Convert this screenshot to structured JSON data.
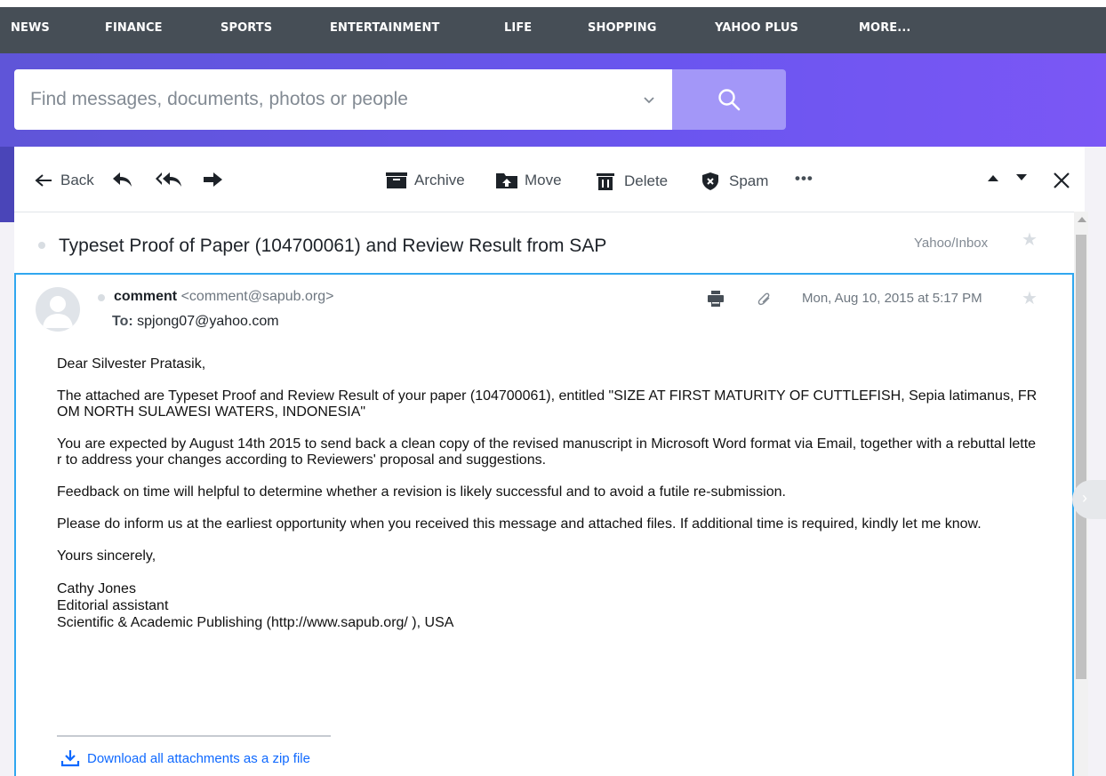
{
  "nav": {
    "items": [
      "NEWS",
      "FINANCE",
      "SPORTS",
      "ENTERTAINMENT",
      "LIFE",
      "SHOPPING",
      "YAHOO PLUS",
      "MORE..."
    ]
  },
  "search": {
    "placeholder": "Find messages, documents, photos or people"
  },
  "toolbar": {
    "back_label": "Back",
    "archive_label": "Archive",
    "move_label": "Move",
    "delete_label": "Delete",
    "spam_label": "Spam",
    "more_label": "•••"
  },
  "message": {
    "subject": "Typeset Proof of Paper (104700061) and Review Result from SAP",
    "folder": "Yahoo/Inbox",
    "sender_name": "comment",
    "sender_email": "<comment@sapub.org>",
    "to_label": "To:",
    "to_address": "spjong07@yahoo.com",
    "date": "Mon, Aug 10, 2015 at 5:17 PM",
    "body": {
      "greeting": "Dear Silvester Pratasik,",
      "p1": "The attached are Typeset Proof and Review Result of your paper (104700061), entitled \"SIZE AT FIRST MATURITY OF CUTTLEFISH, Sepia latimanus, FROM NORTH SULAWESI WATERS, INDONESIA\"",
      "p2": "You are expected by August 14th 2015 to send back a clean copy of the revised manuscript in Microsoft Word format via Email, together with a rebuttal letter to address your changes according to Reviewers' proposal and suggestions.",
      "p3": "Feedback on time will helpful to determine whether a revision is likely successful and to avoid a futile re-submission.",
      "p4": "Please do inform us at the earliest opportunity when you received this message and attached files. If additional time is required, kindly let me know.",
      "closing": "Yours sincerely,",
      "sig_name": "Cathy Jones",
      "sig_title": "Editorial assistant",
      "sig_org": "Scientific & Academic Publishing (http://www.sapub.org/ ), USA"
    },
    "download_label": "Download all attachments as a zip file"
  },
  "colors": {
    "nav_bg": "#464e56",
    "header_gradient_start": "#5f55d8",
    "header_gradient_end": "#7b57f5",
    "search_button": "#a397f8",
    "message_border": "#30a7ef",
    "link": "#0f69ff"
  }
}
